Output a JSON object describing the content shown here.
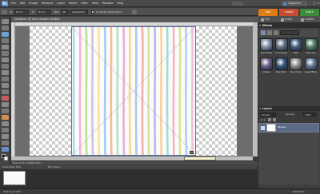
{
  "app": {
    "logo": "Ps"
  },
  "menubar": {
    "items": [
      "File",
      "Edit",
      "Image",
      "Enhance",
      "Layer",
      "Select",
      "Filter",
      "View",
      "Window",
      "Help"
    ],
    "undo_label": "",
    "organizer_label": "Organizer"
  },
  "options": {
    "width_label": "W:",
    "width_value": "8.5 in",
    "height_label": "H:",
    "height_value": "8.5 in",
    "res_label": "Res:",
    "res_value": "96",
    "unit": "pixels/inch",
    "constrain_label": "Constrain Proportions"
  },
  "tabs": [
    {
      "label": "Edit",
      "color": "#e07b1a"
    },
    {
      "label": "Create",
      "color": "#c94b2f"
    },
    {
      "label": "Share",
      "color": "#3f8a3a"
    }
  ],
  "modes": [
    "Full",
    "Quick",
    "Guided"
  ],
  "document": {
    "title": "Untitled-1 @ 50% (Stripes, RGB/8)",
    "tooltip": "",
    "status": "Document: 3.00M/3.00M"
  },
  "stripe_colors": [
    "#9fd3e8",
    "#f3a8c8",
    "#b6d97a",
    "#c8b4e8",
    "#f9e07a",
    "#8fc6f0",
    "#f6b07a",
    "#a6dcb8",
    "#e59fd0",
    "#f5d36a",
    "#9fbfe8",
    "#f39f9f",
    "#c5e38a",
    "#b9a6e6",
    "#f7c98a",
    "#93d6d0",
    "#f4a6b8",
    "#d2e07a",
    "#a5c7ef",
    "#f0b2d8"
  ],
  "panel": {
    "effects_title": "Effects",
    "effects": [
      {
        "label": "Drop Shadow",
        "color": "#7c8ca3"
      },
      {
        "label": "Inner Shadow",
        "color": "#5f6d82"
      },
      {
        "label": "Bevel",
        "color": "#3f5a7a"
      },
      {
        "label": "Outer Glow",
        "color": "#4d7a5f"
      },
      {
        "label": "Complex",
        "color": "#6a5a82"
      },
      {
        "label": "Wow Plastic",
        "color": "#2f4f6f"
      },
      {
        "label": "Wow Chrome",
        "color": "#8a8a8a"
      },
      {
        "label": "Image Effects",
        "color": "#5a6f8a"
      }
    ],
    "layers_title": "Layers",
    "blend_mode": "Normal",
    "opacity_label": "Opacity:",
    "opacity_value": "100%",
    "lock_label": "Lock:",
    "layer_name": "Stripes"
  },
  "bin": {
    "title": "Show Open Files",
    "subtitle": "Bin Actions"
  },
  "bottombar": {
    "label": "Hide Project Bin",
    "right_label": "Palette Bin"
  }
}
